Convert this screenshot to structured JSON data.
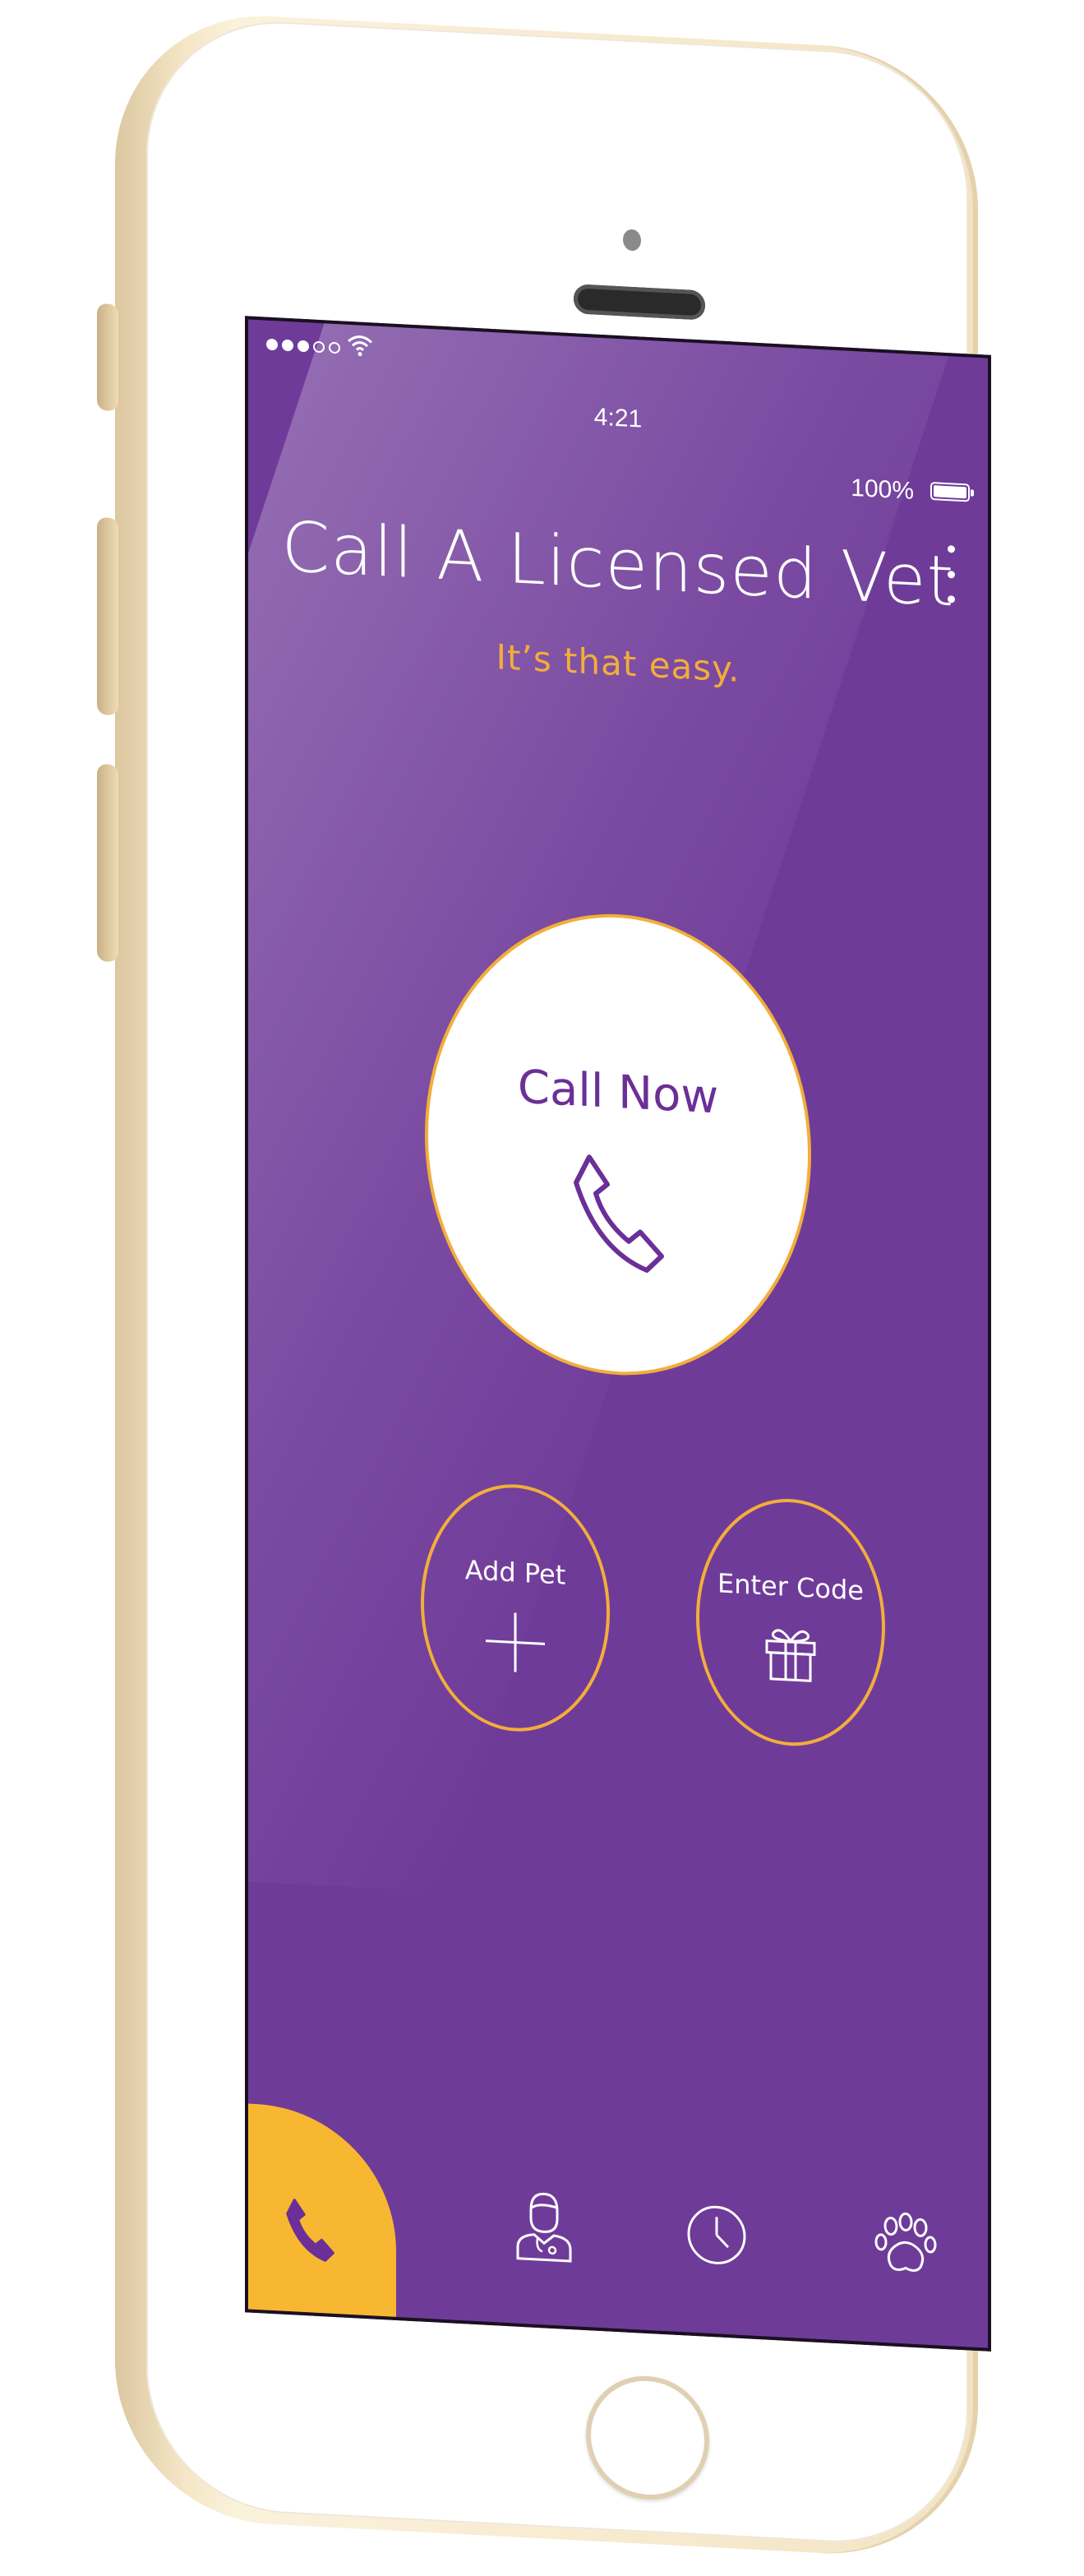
{
  "status_bar": {
    "time": "4:21",
    "battery": "100%",
    "signal_bars_filled": 3,
    "signal_bars_total": 5
  },
  "header": {
    "title": "Call A Licensed Vet",
    "subtitle": "It’s that easy."
  },
  "actions": {
    "call_now_label": "Call Now",
    "add_pet_label": "Add Pet",
    "enter_code_label": "Enter Code"
  },
  "tab_bar": {
    "items": [
      {
        "icon": "phone-icon",
        "selected": true
      },
      {
        "icon": "vet-doctor-icon",
        "selected": false
      },
      {
        "icon": "clock-icon",
        "selected": false
      },
      {
        "icon": "paw-icon",
        "selected": false
      }
    ]
  },
  "colors": {
    "screen_purple": "#6f3b99",
    "accent_orange": "#f2ae3a",
    "tab_active": "#f7b731",
    "button_text_purple": "#6b2f97",
    "device_gold": "#f4e6c6"
  }
}
